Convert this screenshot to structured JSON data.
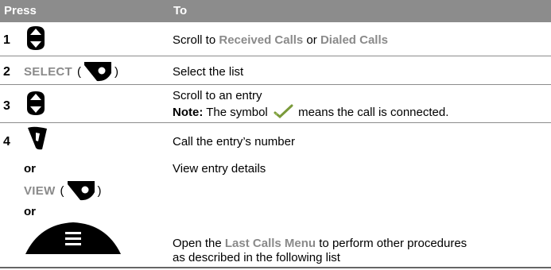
{
  "header": {
    "press": "Press",
    "to": "To"
  },
  "rows": [
    {
      "num": "1",
      "text_pre": "Scroll to ",
      "hl1": "Received Calls",
      "text_mid": " or ",
      "hl2": "Dialed Calls"
    },
    {
      "num": "2",
      "softkey": "SELECT",
      "paren_open": "(",
      "paren_close": ")",
      "text": "Select the list"
    },
    {
      "num": "3",
      "text": "Scroll to an entry",
      "note_label": "Note:",
      "note_pre": " The symbol ",
      "note_post": " means the call is connected."
    },
    {
      "num": "4",
      "text": "Call the entry’s number"
    }
  ],
  "alt1": {
    "or": "or",
    "text": "View entry details",
    "softkey": "VIEW",
    "paren_open": "(",
    "paren_close": ")"
  },
  "alt2": {
    "or": "or",
    "text_pre": "Open the ",
    "hl": "Last Calls Menu",
    "text_post": " to perform other procedures",
    "text_line2": "as described in the following list"
  }
}
